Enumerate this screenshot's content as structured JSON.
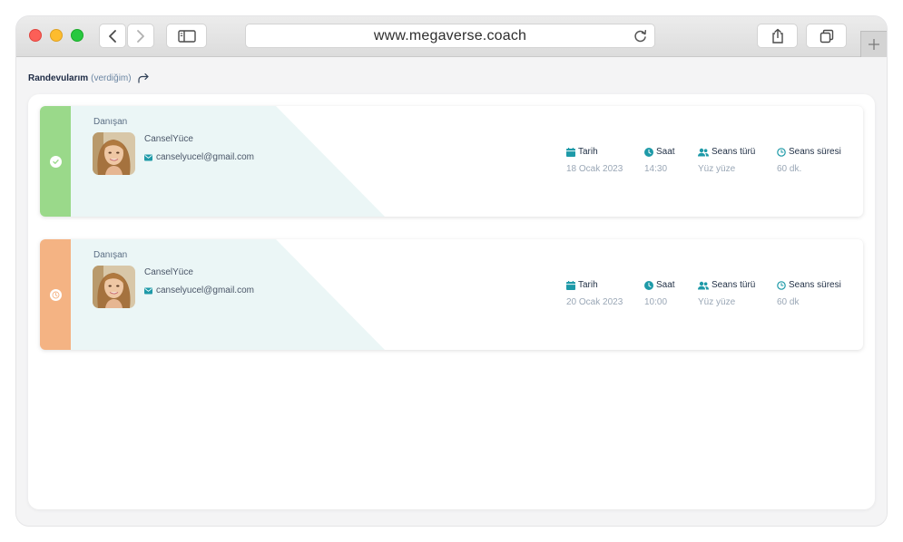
{
  "browser": {
    "url": "www.megaverse.coach"
  },
  "page": {
    "title": "Randevularım",
    "subtitle": "(verdiğim)"
  },
  "colors": {
    "accent": "#1e9aa8",
    "completed": "#9ad98a",
    "pending": "#f4b383"
  },
  "appointments": [
    {
      "status": "completed",
      "status_icon": "check-icon",
      "client_label": "Danışan",
      "client_name": "CanselYüce",
      "client_email": "canselyucel@gmail.com",
      "date_label": "Tarih",
      "date": "18 Ocak 2023",
      "time_label": "Saat",
      "time": "14:30",
      "type_label": "Seans türü",
      "type": "Yüz yüze",
      "duration_label": "Seans süresi",
      "duration": "60 dk."
    },
    {
      "status": "pending",
      "status_icon": "clock-icon",
      "client_label": "Danışan",
      "client_name": "CanselYüce",
      "client_email": "canselyucel@gmail.com",
      "date_label": "Tarih",
      "date": "20 Ocak 2023",
      "time_label": "Saat",
      "time": "10:00",
      "type_label": "Seans türü",
      "type": "Yüz yüze",
      "duration_label": "Seans süresi",
      "duration": "60 dk"
    }
  ]
}
